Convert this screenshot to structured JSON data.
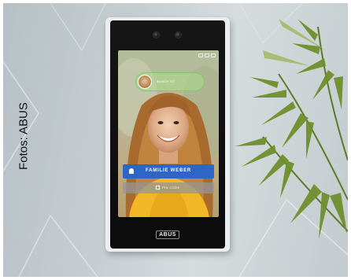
{
  "caption": "Fotos: ABUS",
  "screen": {
    "call_label": "BOSCH ST.",
    "name_button_label": "FAMILIE WEBER",
    "pin_button_label": "PIN CODE",
    "bell_icon": "bell-icon",
    "keypad_icon": "keypad-icon"
  },
  "device": {
    "brand_logo": "ABUS"
  },
  "colors": {
    "name_button": "#2f64c8",
    "call_pill": "#7fcf6a"
  }
}
